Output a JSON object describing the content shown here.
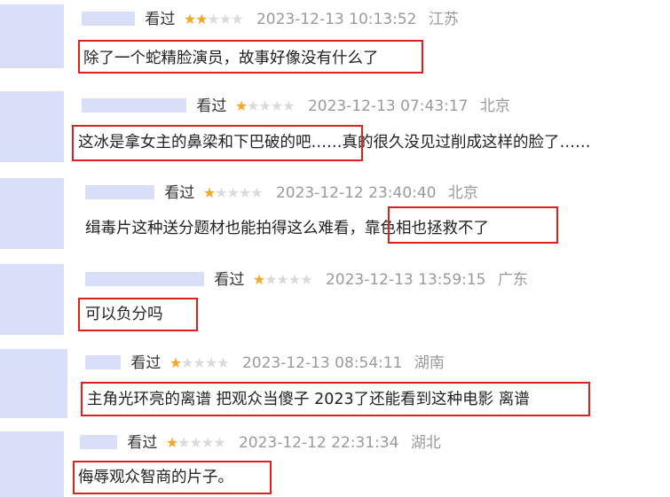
{
  "comments": [
    {
      "status": "看过",
      "rating": 2,
      "date": "2023-12-13 10:13:52",
      "location": "江苏",
      "text_pre": "",
      "text_hl": "除了一个蛇精脸演员，故事好像没有什么了",
      "text_post": ""
    },
    {
      "status": "看过",
      "rating": 1,
      "date": "2023-12-13 07:43:17",
      "location": "北京",
      "text_pre": "",
      "text_hl": "这冰是拿女主的鼻梁和下巴破的吧",
      "text_post": "……真的很久没见过削成这样的脸了……"
    },
    {
      "status": "看过",
      "rating": 1,
      "date": "2023-12-12 23:40:40",
      "location": "北京",
      "text_pre": "缉毒片这种送分题材也能拍得这么难看，",
      "text_hl": "靠色相也拯救不了",
      "text_post": ""
    },
    {
      "status": "看过",
      "rating": 1,
      "date": "2023-12-13 13:59:15",
      "location": "广东",
      "text_pre": "",
      "text_hl": "可以负分吗",
      "text_post": ""
    },
    {
      "status": "看过",
      "rating": 1,
      "date": "2023-12-13 08:54:11",
      "location": "湖南",
      "text_pre": "",
      "text_hl": "主角光环亮的离谱 把观众当傻子 2023了还能看到这种电影 离谱",
      "text_post": ""
    },
    {
      "status": "看过",
      "rating": 1,
      "date": "2023-12-12 22:31:34",
      "location": "湖北",
      "text_pre": "",
      "text_hl": "侮辱观众智商的片子。",
      "text_post": ""
    }
  ],
  "star_icons": {
    "filled": "★",
    "empty": "★"
  },
  "colors": {
    "highlight_border": "#e0201e",
    "star_filled": "#f5a623",
    "star_empty": "#dadada",
    "placeholder": "#d9def9"
  }
}
